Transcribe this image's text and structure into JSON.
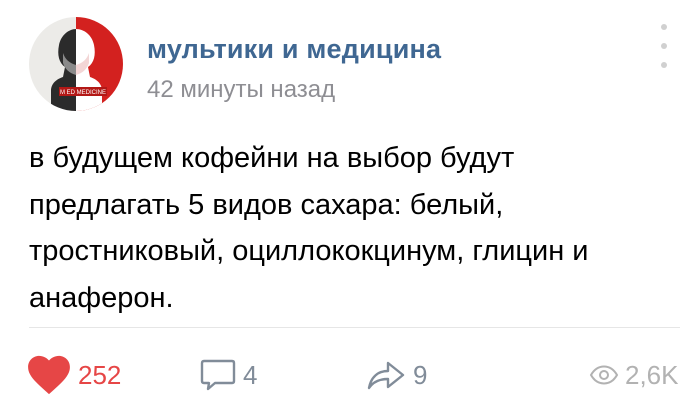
{
  "post": {
    "author": "мультики и медицина",
    "time": "42 минуты назад",
    "avatar_caption": "M ED MEDICINE",
    "text": "в будущем кофейни на выбор будут предлагать 5 видов сахара: белый, тростниковый, оциллококцинум, глицин и анаферон."
  },
  "actions": {
    "likes": "252",
    "comments": "4",
    "shares": "9",
    "views": "2,6K"
  },
  "colors": {
    "author": "#3f6792",
    "like": "#e64646",
    "muted": "#818c99",
    "avatar_red": "#d3211f"
  },
  "icons": {
    "like": "heart-icon",
    "comment": "comment-bubble-icon",
    "share": "share-arrow-icon",
    "views": "eye-icon",
    "menu": "more-vertical-icon"
  }
}
